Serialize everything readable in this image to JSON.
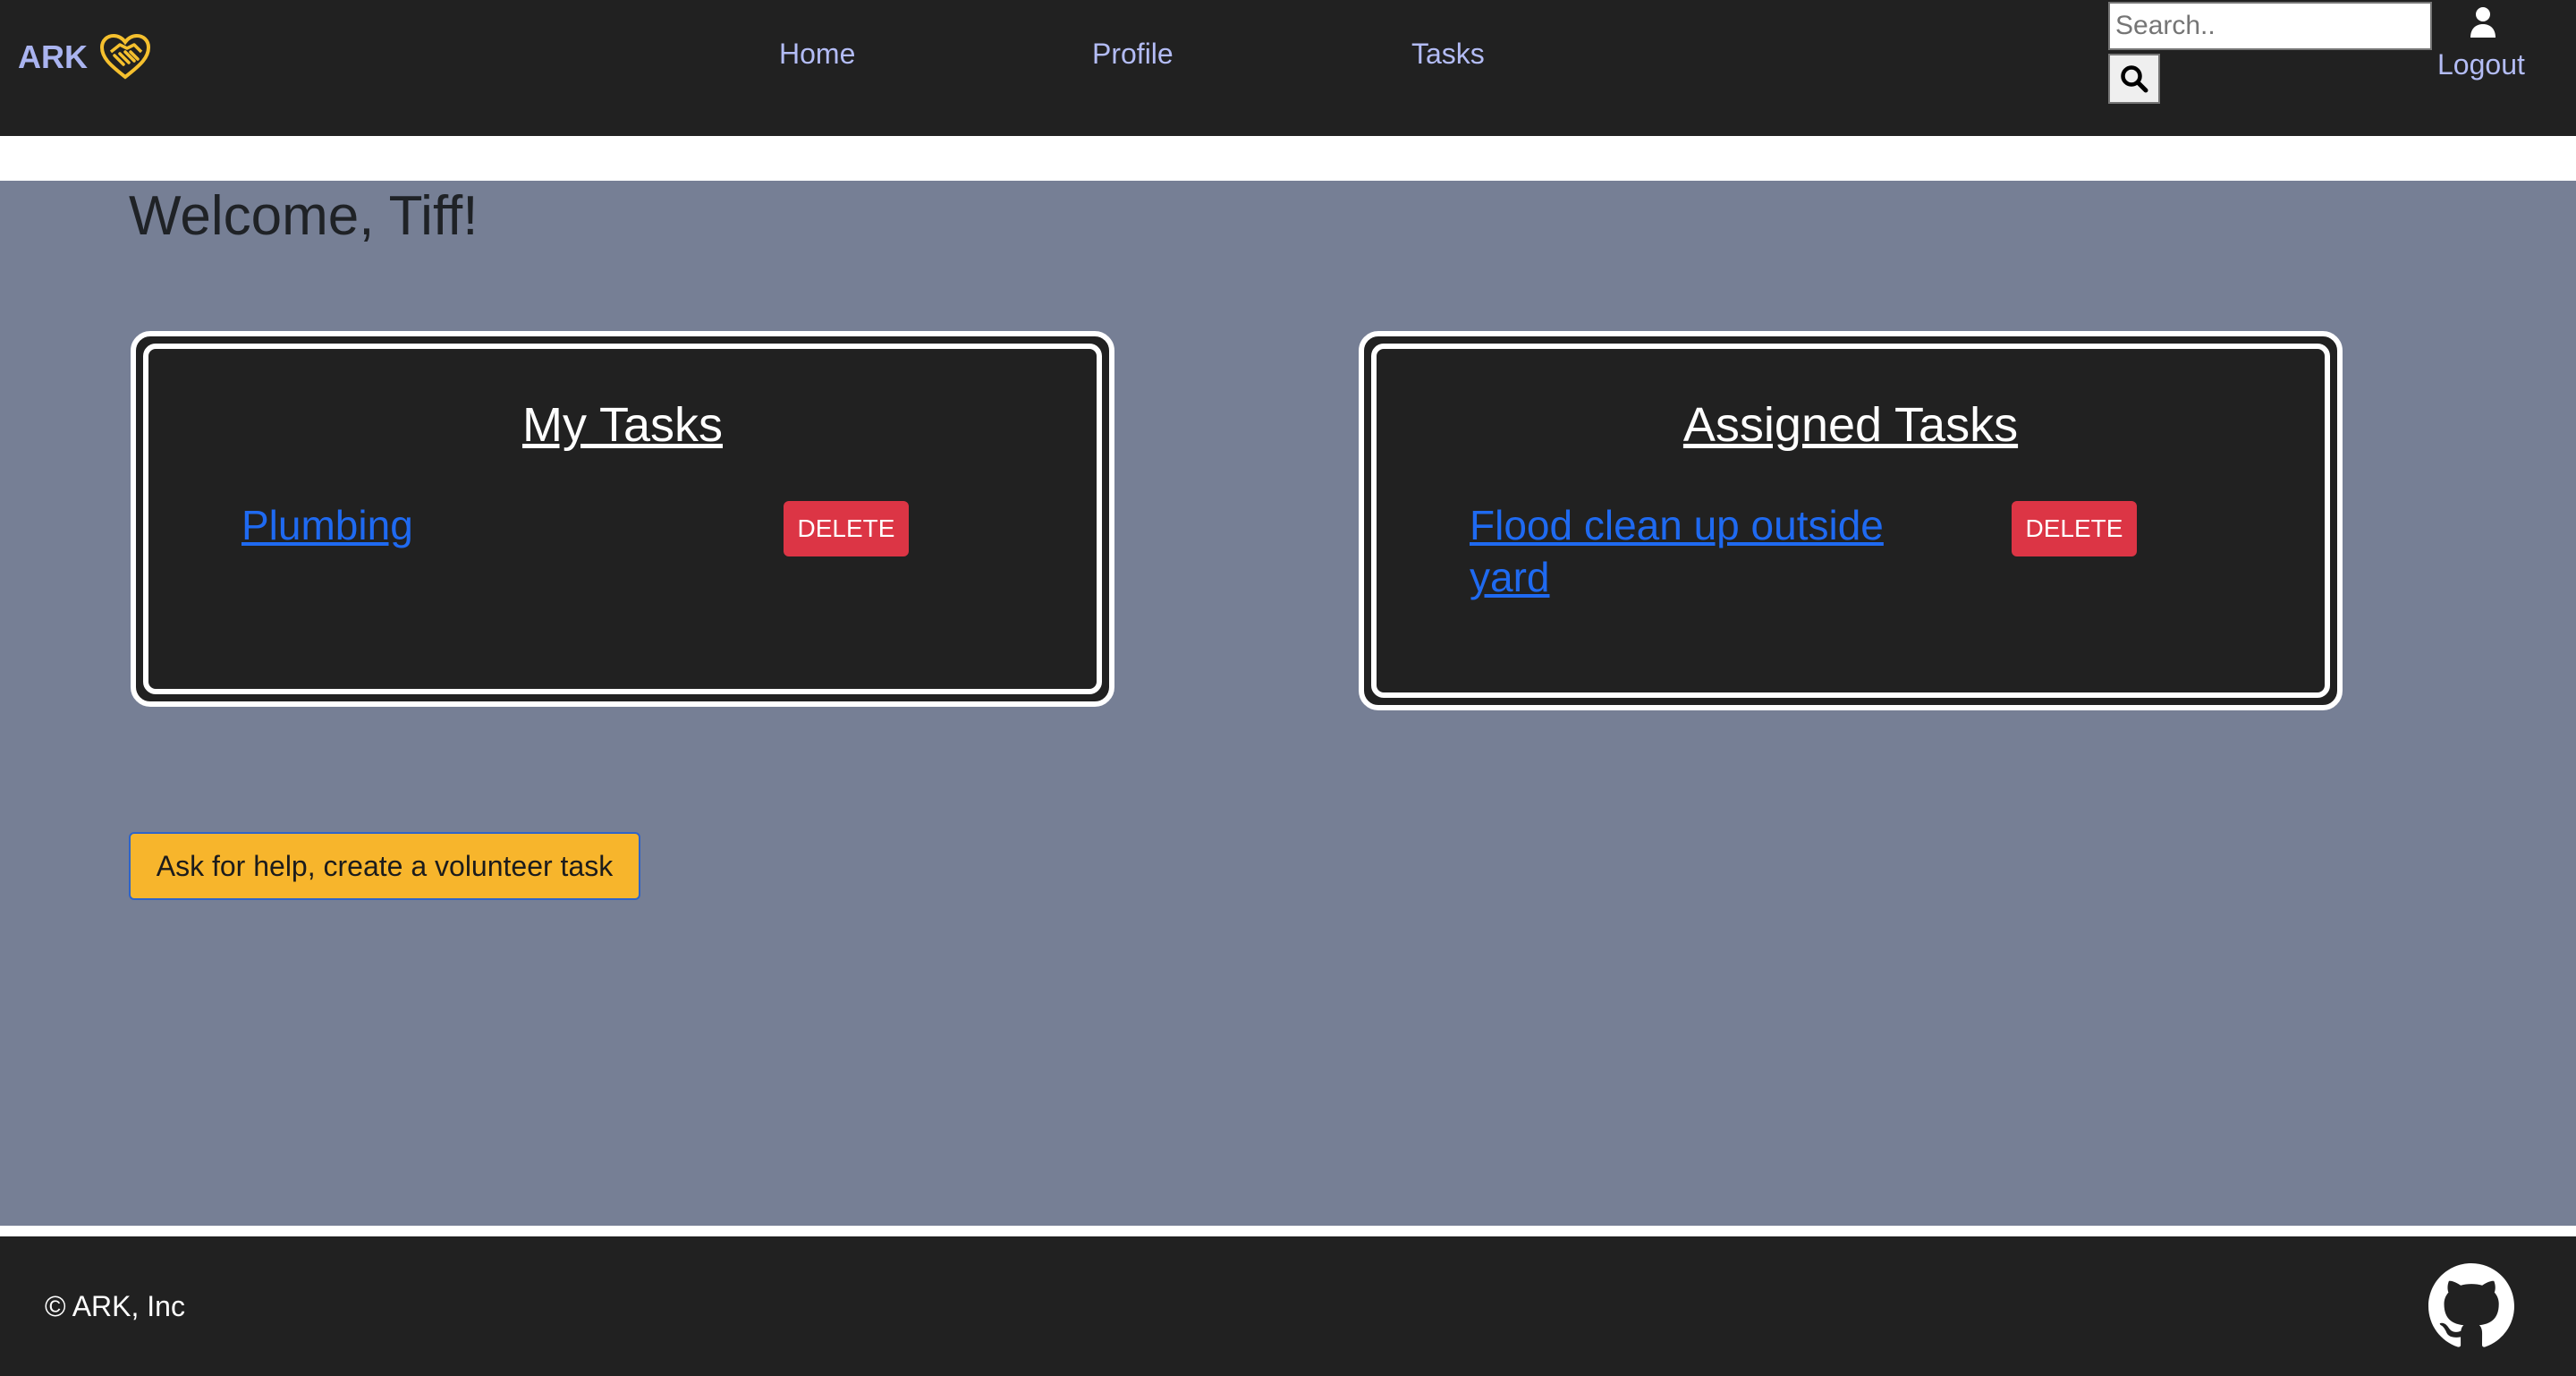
{
  "nav": {
    "brand": "ARK",
    "links": {
      "home": "Home",
      "profile": "Profile",
      "tasks": "Tasks"
    },
    "search_placeholder": "Search..",
    "logout": "Logout"
  },
  "main": {
    "welcome": "Welcome, Tiff!",
    "my_tasks": {
      "title": "My Tasks",
      "items": [
        {
          "label": "Plumbing",
          "delete_label": "DELETE"
        }
      ]
    },
    "assigned_tasks": {
      "title": "Assigned Tasks",
      "items": [
        {
          "label": "Flood clean up outside yard",
          "delete_label": "DELETE"
        }
      ]
    },
    "help_button": "Ask for help, create a volunteer task"
  },
  "footer": {
    "copyright": "© ARK, Inc"
  },
  "colors": {
    "navbar_bg": "#212121",
    "main_bg": "#767f95",
    "link": "#1f6af1",
    "delete": "#dc3545",
    "help_button": "#f7b52c",
    "brand_heart": "#f5c02e"
  },
  "icons": {
    "brand": "heart-handshake-icon",
    "search": "search-icon",
    "user": "user-icon",
    "github": "github-icon"
  }
}
